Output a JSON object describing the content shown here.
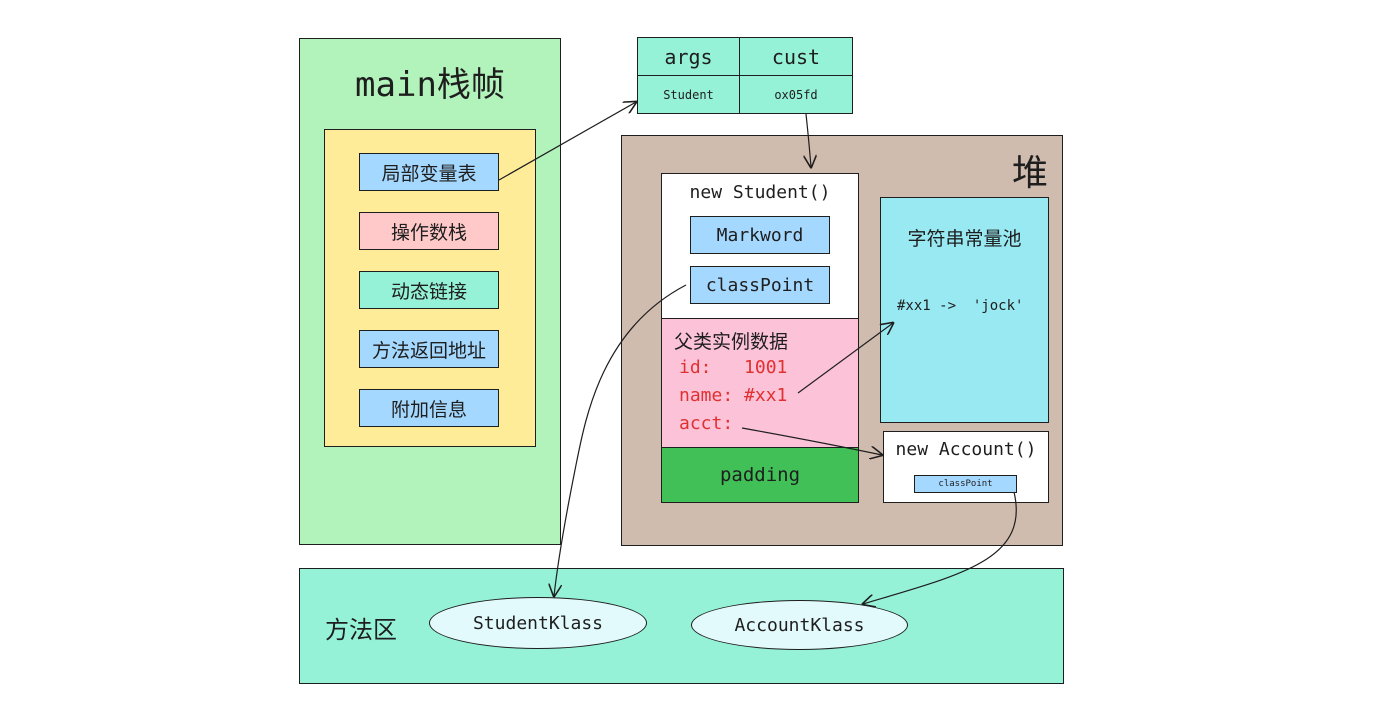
{
  "stack_frame": {
    "title": "main栈帧",
    "slots": [
      "局部变量表",
      "操作数栈",
      "动态链接",
      "方法返回地址",
      "附加信息"
    ]
  },
  "locals_table": {
    "headers": [
      "args",
      "cust"
    ],
    "values": [
      "Student",
      "ox05fd"
    ]
  },
  "heap": {
    "title": "堆",
    "student_object": {
      "title": "new Student()",
      "header_fields": [
        "Markword",
        "classPoint"
      ],
      "parent_data_title": "父类实例数据",
      "fields": [
        "id:   1001",
        "name: #xx1",
        "acct:"
      ],
      "padding_label": "padding"
    },
    "string_pool": {
      "title": "字符串常量池",
      "entry": "#xx1 ->  'jock'"
    },
    "account_object": {
      "title": "new Account()",
      "field": "classPoint"
    }
  },
  "method_area": {
    "title": "方法区",
    "klasses": [
      "StudentKlass",
      "AccountKlass"
    ]
  },
  "colors": {
    "frame": "#b2f2bb",
    "frame_inner": "#ffec99",
    "blue_slot": "#a5d8ff",
    "red_slot": "#ffc9c9",
    "teal": "#96f2d7",
    "heap": "#d0bbaf",
    "pink": "#fcc2d7",
    "field_text": "#e03131",
    "padding": "#40c057",
    "string_pool": "#99e9f2",
    "ellipse": "#e3fafc"
  }
}
